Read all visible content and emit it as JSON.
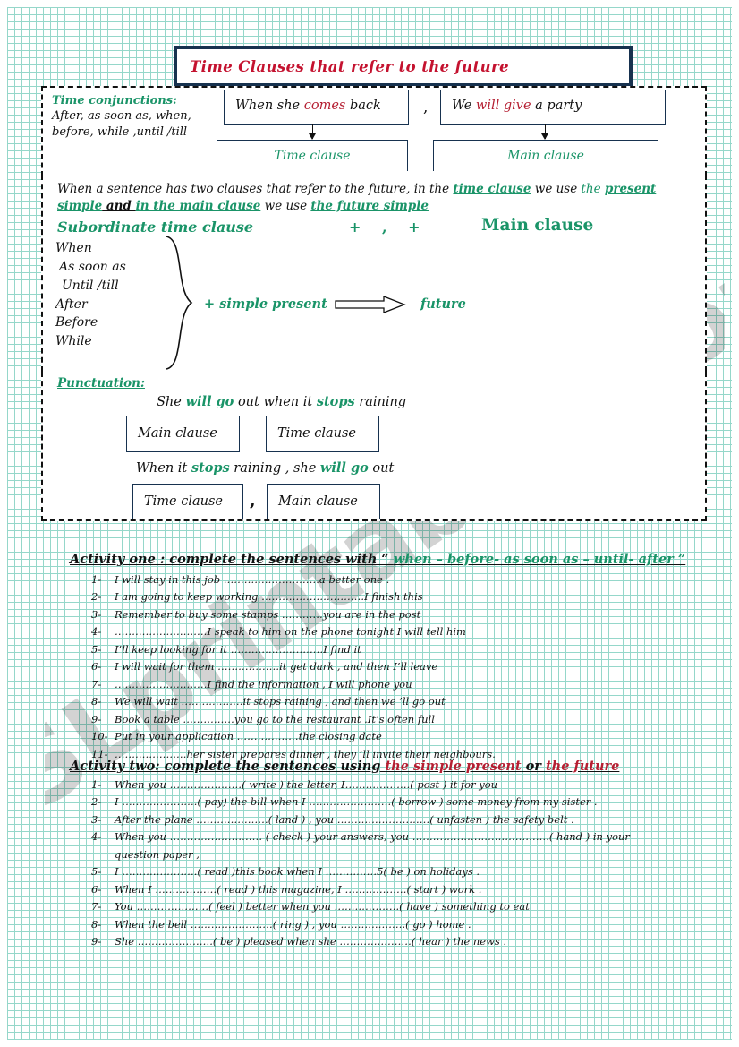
{
  "title": "Time Clauses that refer to the future",
  "watermark": "ESLprintables.com",
  "colors": {
    "title_red": "#c4122f",
    "green": "#1a9468",
    "navy": "#17324f",
    "grid": "#3fb7a0"
  },
  "conjunctions_box": {
    "heading": "Time conjunctions:",
    "line1": "After, as soon as, when,",
    "line2": "before, while ,until /till"
  },
  "examples": {
    "time_clause_sentence_pre": "When she ",
    "time_clause_sentence_hl": "comes",
    "time_clause_sentence_post": " back",
    "comma": ",",
    "main_clause_sentence_pre": "We ",
    "main_clause_sentence_hl": "will give",
    "main_clause_sentence_post": " a party",
    "label_time": "Time clause",
    "label_main": "Main clause"
  },
  "rule": {
    "p1": "When a sentence has two clauses that refer to the future, in the ",
    "p2": "time clause",
    "p3": " we use ",
    "p4": "the ",
    "p5": "present simple",
    "p6": " and ",
    "p7": "in the main clause",
    "p8": " we use ",
    "p9": "the future simple",
    "subordinate_heading": "Subordinate time clause",
    "plus_comma_plus": "+ , +",
    "main_heading": "Main clause"
  },
  "conjunction_list": [
    "When",
    "As soon as",
    "Until /till",
    "After",
    "Before",
    "While"
  ],
  "formula": {
    "left": "+ simple present",
    "right": "future"
  },
  "punctuation": {
    "heading": "Punctuation:",
    "example1_a": "She ",
    "example1_b": "will go",
    "example1_c": " out when it ",
    "example1_d": "stops",
    "example1_e": " raining",
    "box1": "Main clause",
    "box2": "Time clause",
    "example2_a": "When it ",
    "example2_b": "stops",
    "example2_c": " raining , she ",
    "example2_d": "will go",
    "example2_e": " out",
    "box3": "Time clause",
    "comma": ",",
    "box4": "Main clause"
  },
  "activity_one": {
    "heading_plain": "Activity one : complete the sentences with  “ ",
    "heading_green": "when – before-  as soon as – until- after",
    "heading_tail": "  ”",
    "items": [
      {
        "n": "1-",
        "text": "I will stay in this job ……………………….a better one ."
      },
      {
        "n": "2-",
        "text": "I am going to keep working …………………………I finish this"
      },
      {
        "n": "3-",
        "text": "Remember to buy some stamps …………you are in the post"
      },
      {
        "n": "4-",
        "text": "………………………I speak to him on the phone tonight  I will tell him"
      },
      {
        "n": "5-",
        "text": "I’ll keep looking for it ………………………I find it"
      },
      {
        "n": "6-",
        "text": "I will wait for them ………………it get dark ,  and then I’ll leave"
      },
      {
        "n": "7-",
        "text": "………………………I find the information , I will phone you"
      },
      {
        "n": "8-",
        "text": "We will wait ………………it stops raining , and then we ’ll go out"
      },
      {
        "n": "9-",
        "text": "Book a table ……………you go to the restaurant .It’s often full"
      },
      {
        "n": "10-",
        "text": "Put in your application ………………the closing date"
      },
      {
        "n": "11-",
        "text": "…………………her sister prepares dinner , they ’ll invite their neighbours."
      }
    ]
  },
  "activity_two": {
    "heading_plain": "Activity two:  complete the sentences using ",
    "heading_red1": "the simple present",
    "heading_mid": " or ",
    "heading_red2": "the future",
    "items": [
      {
        "n": "1-",
        "text": "When you …………………( write ) the letter, I……………….( post ) it for you"
      },
      {
        "n": "2-",
        "text": "I ………………….( pay)  the bill when I ……………………( borrow ) some money from my sister ."
      },
      {
        "n": "3-",
        "text": "After the plane …………………( land ) , you ………………………( unfasten ) the safety belt ."
      },
      {
        "n": "4-",
        "text": "When you ……………………… ( check ) your answers, you ………………………………….( hand ) in your"
      },
      {
        "n": "",
        "text": "question paper ,"
      },
      {
        "n": "5-",
        "text": "I ………………….( read )this book when I ……………5( be ) on holidays ."
      },
      {
        "n": "6-",
        "text": "When I ………………( read ) this magazine, I ………………( start ) work ."
      },
      {
        "n": "7-",
        "text": "You …………………( feel ) better when you ……………….( have ) something to eat"
      },
      {
        "n": "8-",
        "text": "When the bell ……………………( ring ) , you ……………….( go ) home ."
      },
      {
        "n": "9-",
        "text": "She ………………….( be ) pleased when she …………………( hear ) the news ."
      }
    ]
  }
}
